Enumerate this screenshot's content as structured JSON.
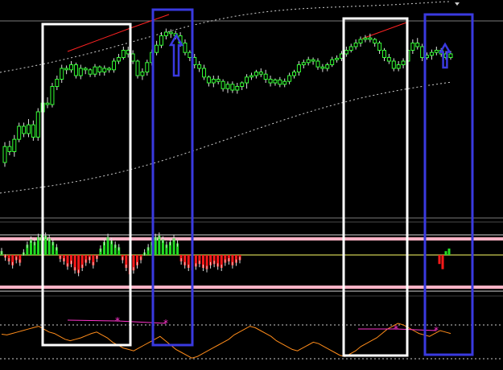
{
  "colors": {
    "background": "#000000",
    "bull": "#22dd22",
    "bear": "#ff1a1a",
    "band": "#ffffff",
    "trend": "#ff2222",
    "oscillator": "#ff8c1a",
    "osc_trend": "#ff33cc",
    "highlight_white": "#ffffff",
    "highlight_blue": "#3a3ae0",
    "level_yellow": "#ffff66",
    "level_pink": "#ffb3c6",
    "level_white": "#cfcfcf",
    "grid": "#7a7a7a"
  },
  "icons": [
    "up-arrow-icon",
    "up-arrow-icon"
  ],
  "chart_data": {
    "type": "candlestick",
    "title": "",
    "panels": [
      "price",
      "histogram",
      "oscillator"
    ],
    "price_series": [
      [
        200,
        178,
        206,
        172
      ],
      [
        178,
        185,
        190,
        170
      ],
      [
        185,
        168,
        192,
        162
      ],
      [
        168,
        150,
        172,
        145
      ],
      [
        150,
        160,
        165,
        145
      ],
      [
        160,
        148,
        165,
        140
      ],
      [
        148,
        165,
        170,
        142
      ],
      [
        165,
        130,
        170,
        125
      ],
      [
        130,
        118,
        135,
        112
      ],
      [
        118,
        120,
        125,
        110
      ],
      [
        120,
        95,
        124,
        90
      ],
      [
        95,
        85,
        100,
        80
      ],
      [
        85,
        70,
        90,
        65
      ],
      [
        70,
        72,
        78,
        66
      ],
      [
        72,
        65,
        76,
        60
      ],
      [
        65,
        80,
        84,
        62
      ],
      [
        80,
        70,
        85,
        65
      ],
      [
        70,
        72,
        78,
        68
      ],
      [
        72,
        78,
        82,
        70
      ],
      [
        78,
        68,
        82,
        64
      ],
      [
        68,
        75,
        80,
        66
      ],
      [
        75,
        70,
        80,
        66
      ],
      [
        70,
        72,
        76,
        68
      ],
      [
        72,
        60,
        76,
        56
      ],
      [
        60,
        55,
        64,
        50
      ],
      [
        55,
        45,
        58,
        40
      ],
      [
        45,
        50,
        55,
        40
      ],
      [
        50,
        60,
        64,
        45
      ],
      [
        60,
        80,
        84,
        58
      ],
      [
        80,
        75,
        86,
        70
      ],
      [
        75,
        62,
        80,
        58
      ],
      [
        62,
        48,
        66,
        44
      ],
      [
        48,
        38,
        52,
        32
      ],
      [
        38,
        25,
        42,
        20
      ],
      [
        25,
        20,
        30,
        15
      ],
      [
        20,
        22,
        28,
        16
      ],
      [
        22,
        25,
        30,
        18
      ],
      [
        25,
        35,
        40,
        20
      ],
      [
        35,
        48,
        52,
        30
      ],
      [
        48,
        55,
        60,
        45
      ],
      [
        55,
        65,
        70,
        50
      ],
      [
        65,
        70,
        75,
        60
      ],
      [
        70,
        82,
        86,
        65
      ],
      [
        82,
        90,
        95,
        80
      ],
      [
        90,
        85,
        96,
        80
      ],
      [
        85,
        88,
        92,
        80
      ],
      [
        88,
        98,
        102,
        85
      ],
      [
        98,
        92,
        104,
        88
      ],
      [
        92,
        100,
        104,
        88
      ],
      [
        100,
        95,
        105,
        90
      ],
      [
        95,
        90,
        100,
        88
      ],
      [
        90,
        82,
        98,
        78
      ],
      [
        82,
        80,
        86,
        76
      ],
      [
        80,
        75,
        84,
        72
      ],
      [
        75,
        78,
        82,
        70
      ],
      [
        78,
        85,
        90,
        72
      ],
      [
        85,
        90,
        95,
        80
      ],
      [
        90,
        86,
        94,
        84
      ],
      [
        86,
        92,
        96,
        82
      ],
      [
        92,
        88,
        96,
        84
      ],
      [
        88,
        80,
        92,
        76
      ],
      [
        80,
        75,
        84,
        72
      ],
      [
        75,
        65,
        80,
        60
      ],
      [
        65,
        62,
        70,
        58
      ],
      [
        62,
        58,
        66,
        54
      ],
      [
        58,
        60,
        65,
        55
      ],
      [
        60,
        68,
        72,
        56
      ],
      [
        68,
        70,
        75,
        64
      ],
      [
        70,
        65,
        74,
        62
      ],
      [
        65,
        58,
        68,
        54
      ],
      [
        58,
        56,
        62,
        52
      ],
      [
        56,
        50,
        60,
        46
      ],
      [
        50,
        45,
        54,
        40
      ],
      [
        45,
        40,
        48,
        36
      ],
      [
        40,
        35,
        44,
        30
      ],
      [
        35,
        30,
        40,
        26
      ],
      [
        30,
        28,
        34,
        24
      ],
      [
        28,
        30,
        34,
        22
      ],
      [
        30,
        35,
        40,
        28
      ],
      [
        35,
        45,
        50,
        32
      ],
      [
        45,
        55,
        60,
        42
      ],
      [
        55,
        60,
        64,
        50
      ],
      [
        60,
        70,
        74,
        56
      ],
      [
        70,
        65,
        74,
        60
      ],
      [
        65,
        60,
        70,
        56
      ],
      [
        60,
        45,
        64,
        40
      ],
      [
        45,
        35,
        50,
        30
      ],
      [
        35,
        40,
        44,
        28
      ],
      [
        40,
        55,
        60,
        36
      ],
      [
        55,
        52,
        58,
        48
      ],
      [
        52,
        48,
        58,
        44
      ],
      [
        48,
        45,
        52,
        40
      ],
      [
        45,
        50,
        54,
        42
      ],
      [
        50,
        55,
        58,
        46
      ],
      [
        55,
        50,
        58,
        46
      ]
    ],
    "hist_values": [
      3,
      -2,
      -5,
      -8,
      -4,
      -6,
      2,
      8,
      12,
      10,
      14,
      16,
      15,
      13,
      10,
      6,
      -3,
      -5,
      -9,
      -7,
      -12,
      -14,
      -10,
      -6,
      -4,
      -8,
      -3,
      5,
      10,
      14,
      11,
      8,
      6,
      -4,
      -10,
      -15,
      -12,
      -8,
      -4,
      2,
      6,
      10,
      14,
      15,
      12,
      8,
      10,
      13,
      9,
      -5,
      -8,
      -10,
      -12,
      -9,
      -7,
      -10,
      -11,
      -8,
      -7,
      -9,
      -10,
      -6,
      -5,
      -8,
      -6,
      -4
    ],
    "hist_tail_values": [
      -7,
      -11,
      3,
      5
    ],
    "osc_values": [
      5,
      4,
      6,
      8,
      10,
      12,
      14,
      16,
      12,
      8,
      6,
      2,
      -2,
      -4,
      -2,
      0,
      3,
      6,
      8,
      4,
      0,
      -6,
      -10,
      -14,
      -16,
      -18,
      -14,
      -10,
      -6,
      -2,
      2,
      -4,
      -10,
      -16,
      -20,
      -24,
      -28,
      -26,
      -22,
      -18,
      -14,
      -10,
      -6,
      -2,
      4,
      8,
      12,
      16,
      14,
      10,
      6,
      2,
      -4,
      -8,
      -12,
      -16,
      -18,
      -14,
      -10,
      -6,
      -8,
      -12,
      -16,
      -20,
      -24,
      -26,
      -22,
      -18,
      -12,
      -8,
      -4,
      0,
      6,
      12,
      16,
      20,
      18,
      14,
      10,
      6,
      4,
      2,
      6,
      10,
      8,
      6
    ]
  }
}
